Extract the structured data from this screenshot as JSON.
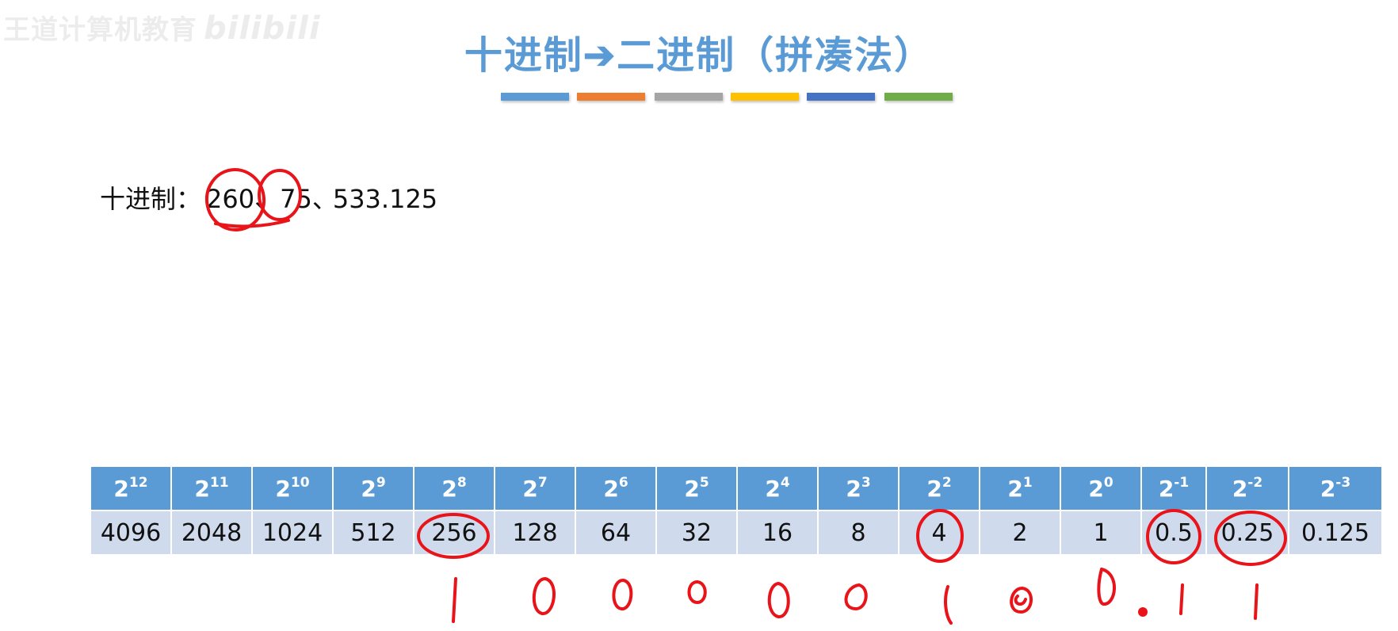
{
  "watermark": {
    "text": "王道计算机教育",
    "logo": "bilibili"
  },
  "title": "十进制➔二进制（拼凑法）",
  "color_bars": [
    "#5b9bd5",
    "#ed7d31",
    "#a5a5a5",
    "#ffc000",
    "#4472c4",
    "#70ad47"
  ],
  "decimal_line": {
    "label": "十进制：",
    "num1": "260",
    "sep1": "、",
    "num2": "75",
    "sep2": "、",
    "num3": "533.125"
  },
  "table": {
    "headers": [
      {
        "base": "2",
        "exp": "12"
      },
      {
        "base": "2",
        "exp": "11"
      },
      {
        "base": "2",
        "exp": "10"
      },
      {
        "base": "2",
        "exp": "9"
      },
      {
        "base": "2",
        "exp": "8"
      },
      {
        "base": "2",
        "exp": "7"
      },
      {
        "base": "2",
        "exp": "6"
      },
      {
        "base": "2",
        "exp": "5"
      },
      {
        "base": "2",
        "exp": "4"
      },
      {
        "base": "2",
        "exp": "3"
      },
      {
        "base": "2",
        "exp": "2"
      },
      {
        "base": "2",
        "exp": "1"
      },
      {
        "base": "2",
        "exp": "0"
      },
      {
        "base": "2",
        "exp": "-1"
      },
      {
        "base": "2",
        "exp": "-2"
      },
      {
        "base": "2",
        "exp": "-3"
      }
    ],
    "values": [
      "4096",
      "2048",
      "1024",
      "512",
      "256",
      "128",
      "64",
      "32",
      "16",
      "8",
      "4",
      "2",
      "1",
      "0.5",
      "0.25",
      "0.125"
    ]
  },
  "handwritten_digits": "100000100.11",
  "ink_color": "#e8141a"
}
